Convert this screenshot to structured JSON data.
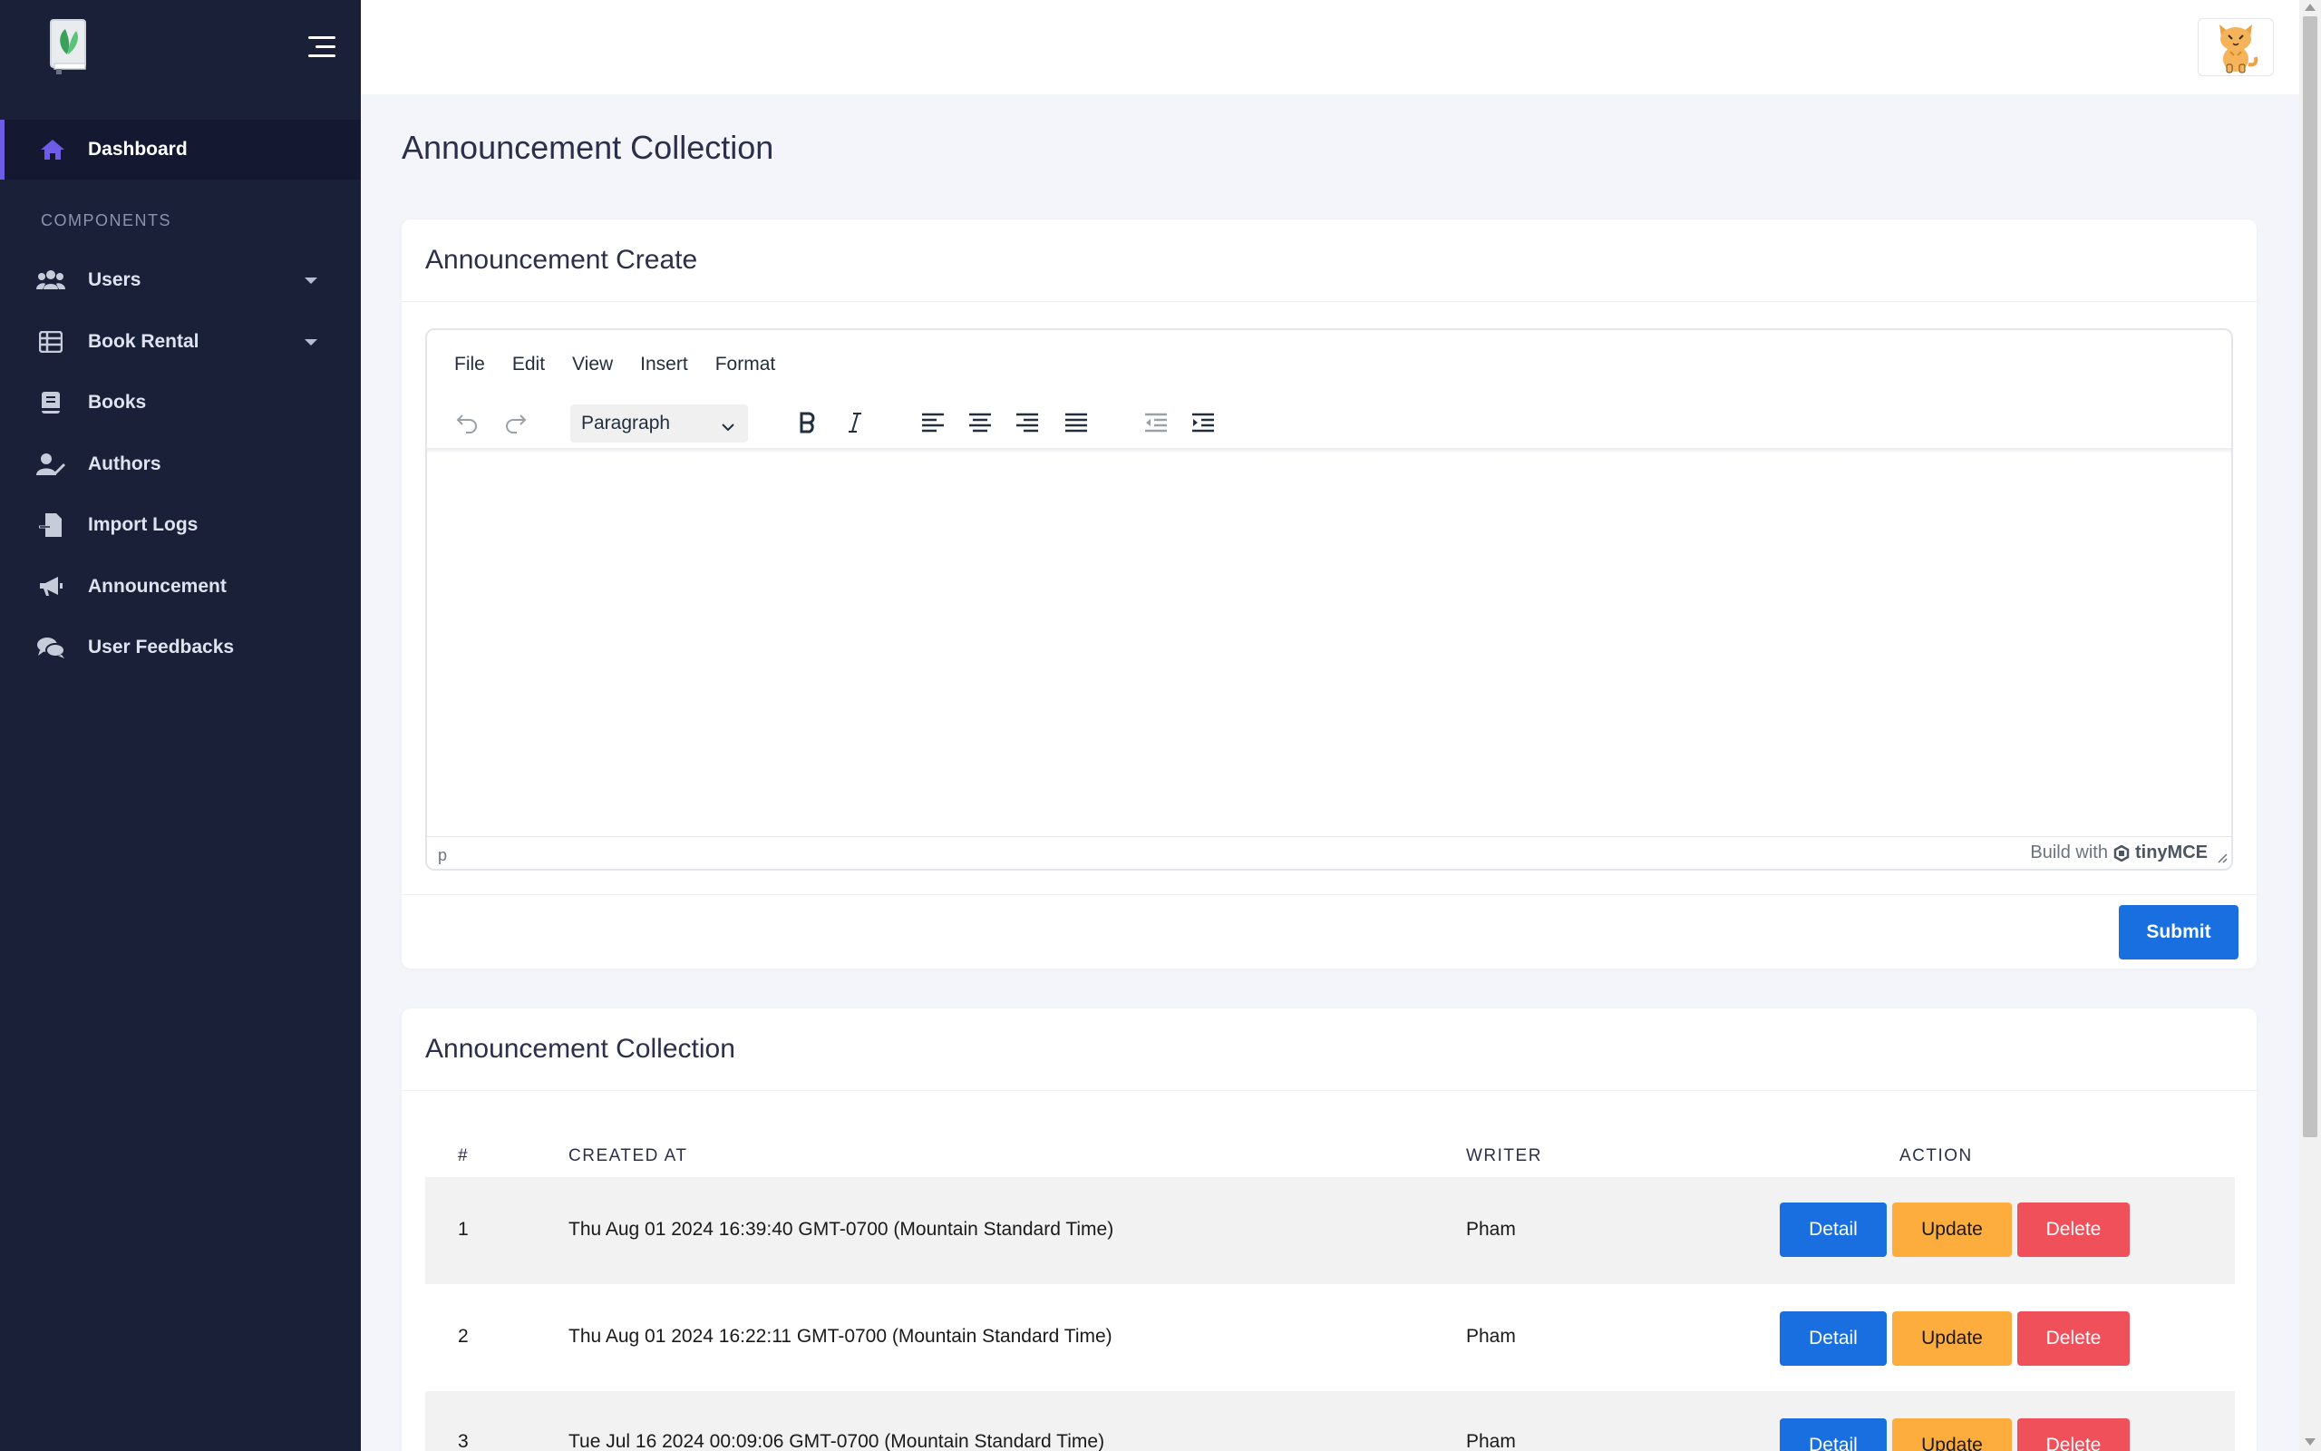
{
  "sidebar": {
    "section_label": "COMPONENTS",
    "accent_color": "#6e5ce6",
    "items": [
      {
        "label": "Dashboard",
        "icon": "home-icon"
      },
      {
        "label": "Users",
        "icon": "users-icon"
      },
      {
        "label": "Book Rental",
        "icon": "table-icon"
      },
      {
        "label": "Books",
        "icon": "book-icon"
      },
      {
        "label": "Authors",
        "icon": "user-edit-icon"
      },
      {
        "label": "Import Logs",
        "icon": "file-import-icon"
      },
      {
        "label": "Announcement",
        "icon": "bullhorn-icon"
      },
      {
        "label": "User Feedbacks",
        "icon": "comments-icon"
      }
    ]
  },
  "page": {
    "title": "Announcement Collection"
  },
  "create_card": {
    "title": "Announcement Create",
    "editor": {
      "menu": [
        "File",
        "Edit",
        "View",
        "Insert",
        "Format"
      ],
      "block_format": "Paragraph",
      "status_path": "p",
      "brand_prefix": "Build with",
      "brand_name": "tinyMCE"
    },
    "submit_label": "Submit"
  },
  "collection_card": {
    "title": "Announcement Collection",
    "columns": [
      "#",
      "CREATED AT",
      "WRITER",
      "ACTION"
    ],
    "rows": [
      {
        "num": "1",
        "created_at": "Thu Aug 01 2024 16:39:40 GMT-0700 (Mountain Standard Time)",
        "writer": "Pham"
      },
      {
        "num": "2",
        "created_at": "Thu Aug 01 2024 16:22:11 GMT-0700 (Mountain Standard Time)",
        "writer": "Pham"
      },
      {
        "num": "3",
        "created_at": "Tue Jul 16 2024 00:09:06 GMT-0700 (Mountain Standard Time)",
        "writer": "Pham"
      }
    ],
    "actions": {
      "detail": "Detail",
      "update": "Update",
      "delete": "Delete"
    }
  },
  "colors": {
    "sidebar_bg": "#1b2039",
    "primary": "#1a6fe0",
    "warning": "#fcad3d",
    "danger": "#f0505a"
  }
}
